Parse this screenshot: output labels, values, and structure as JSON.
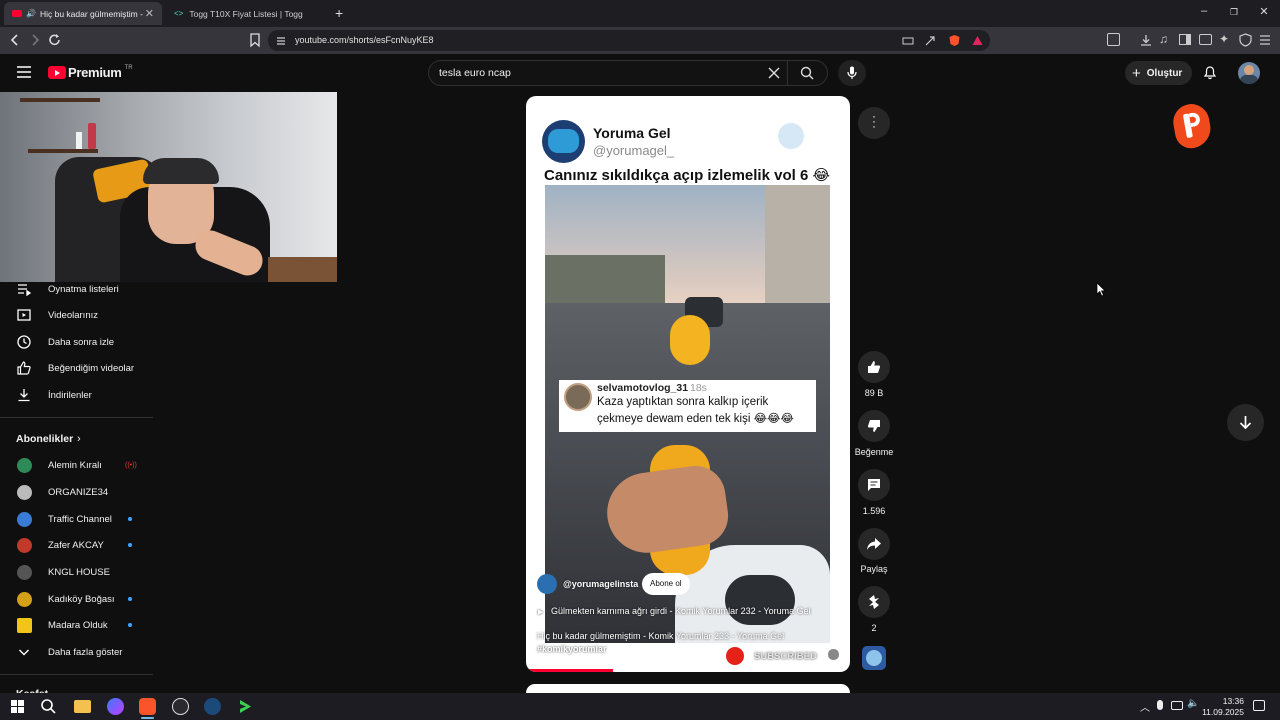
{
  "browser": {
    "tabs": [
      {
        "label": "Hiç bu kadar gülmemiştim - K",
        "active": true
      },
      {
        "label": "Togg T10X Fiyat Listesi | Togg",
        "active": false
      }
    ],
    "url": "youtube.com/shorts/esFcnNuyKE8"
  },
  "youtube": {
    "logo_text": "Premium",
    "logo_sup": "TR",
    "search_value": "tesla euro ncap",
    "create_label": "Oluştur"
  },
  "sidebar": {
    "items": [
      {
        "label": "Oynatma listeleri",
        "icon": "playlist-icon"
      },
      {
        "label": "Videolarınız",
        "icon": "your-videos-icon"
      },
      {
        "label": "Daha sonra izle",
        "icon": "clock-icon"
      },
      {
        "label": "Beğendiğim videolar",
        "icon": "thumbs-up-icon"
      },
      {
        "label": "İndirilenler",
        "icon": "download-icon"
      }
    ],
    "subscriptions_title": "Abonelikler",
    "channels": [
      {
        "name": "Alemin Kıralı",
        "color": "#2e8b57",
        "badge": "live"
      },
      {
        "name": "ORGANIZE34",
        "color": "#bbbbbb",
        "badge": ""
      },
      {
        "name": "Traffic Channel",
        "color": "#3a7bd5",
        "badge": "dot"
      },
      {
        "name": "Zafer AKCAY",
        "color": "#c0392b",
        "badge": "dot"
      },
      {
        "name": "KNGL HOUSE",
        "color": "#555555",
        "badge": ""
      },
      {
        "name": "Kadıköy Boğası",
        "color": "#d4a017",
        "badge": "dot"
      },
      {
        "name": "Madara Olduk",
        "color": "#f0c419",
        "badge": "dot"
      }
    ],
    "show_more": "Daha fazla göster",
    "explore_partial": "Keşfet"
  },
  "short": {
    "account_name": "Yoruma Gel",
    "account_handle": "@yorumagel_",
    "title": "Canınız sıkıldıkça açıp izlemelik vol 6 😂",
    "comment_user": "selvamotovlog_31",
    "comment_time": "18s",
    "comment_text_1": "Kaza yaptıktan sonra kalkıp içerik",
    "comment_text_2": "çekmeye dewam eden tek kişi 😂😂😂",
    "channel_handle": "@yorumagelinsta",
    "subscribe_label": "Abone ol",
    "related_video": "Gülmekten karnıma ağrı girdi - Komik Yorumlar 232 - Yoruma Gel",
    "caption_1": "Hiç bu kadar gülmemiştim - Komik Yorumlar 233 - Yoruma Gel",
    "caption_2": "#komikyorumlar",
    "subscribed_label": "SUBSCRIBED",
    "progress": 0.27
  },
  "actions": {
    "likes": "89 B",
    "dislike": "Beğenme",
    "comments": "1.596",
    "share": "Paylaş",
    "remix": "2"
  },
  "taskbar": {
    "time": "13:36",
    "date": "11.09.2025"
  }
}
